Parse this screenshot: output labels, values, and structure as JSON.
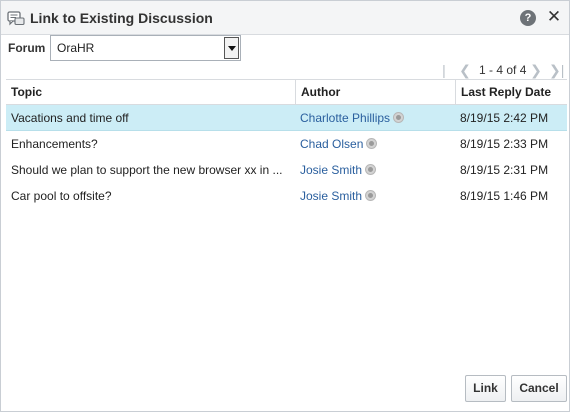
{
  "dialog": {
    "title": "Link to Existing Discussion",
    "help_glyph": "?",
    "close_glyph": "✕"
  },
  "forum": {
    "label": "Forum",
    "selected": "OraHR"
  },
  "pager": {
    "info": "1 - 4 of 4"
  },
  "table": {
    "columns": [
      "Topic",
      "Author",
      "Last Reply Date"
    ],
    "rows": [
      {
        "topic": "Vacations and time off",
        "author": "Charlotte Phillips",
        "date": "8/19/15 2:42 PM",
        "selected": true
      },
      {
        "topic": "Enhancements?",
        "author": "Chad Olsen",
        "date": "8/19/15 2:33 PM",
        "selected": false
      },
      {
        "topic": "Should we plan to support the new browser xx in ...",
        "author": "Josie Smith",
        "date": "8/19/15 2:31 PM",
        "selected": false
      },
      {
        "topic": "Car pool to offsite?",
        "author": "Josie Smith",
        "date": "8/19/15 1:46 PM",
        "selected": false
      }
    ]
  },
  "buttons": {
    "link": "Link",
    "cancel": "Cancel"
  },
  "colors": {
    "selected_row": "#ccedf6",
    "author_link": "#2a5f9e"
  },
  "icons": {
    "title": "discussion-icon",
    "presence": "presence-offline-icon"
  }
}
